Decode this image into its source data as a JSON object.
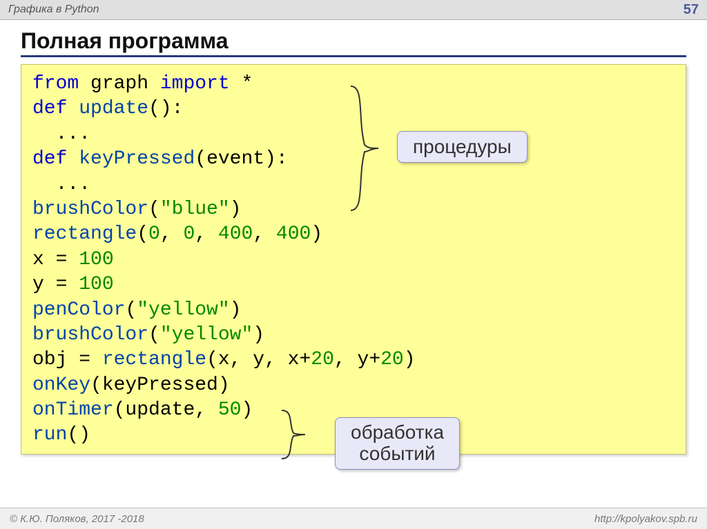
{
  "header": {
    "title": "Графика в Python",
    "page": "57"
  },
  "slide_title": "Полная программа",
  "callouts": {
    "procedures": "процедуры",
    "events_line1": "обработка",
    "events_line2": "событий"
  },
  "code": {
    "l1_from": "from",
    "l1_graph": " graph ",
    "l1_import": "import",
    "l1_star": " *",
    "l2_def": "def",
    "l2_update": " update",
    "l2_par": "():",
    "l3": "  ...",
    "l4_def": "def",
    "l4_kp": " keyPressed",
    "l4_par": "(event):",
    "l5": "  ...",
    "l6_bc": "brushColor",
    "l6_par_open": "(",
    "l6_str": "\"blue\"",
    "l6_par_close": ")",
    "l7_rect": "rectangle",
    "l7_open": "(",
    "l7_n1": "0",
    "l7_c1": ", ",
    "l7_n2": "0",
    "l7_c2": ", ",
    "l7_n3": "400",
    "l7_c3": ", ",
    "l7_n4": "400",
    "l7_close": ")",
    "l8_x": "x = ",
    "l8_n": "100",
    "l9_y": "y = ",
    "l9_n": "100",
    "l10_pc": "penColor",
    "l10_open": "(",
    "l10_str": "\"yellow\"",
    "l10_close": ")",
    "l11_bc": "brushColor",
    "l11_open": "(",
    "l11_str": "\"yellow\"",
    "l11_close": ")",
    "l12_obj": "obj = ",
    "l12_rect": "rectangle",
    "l12_open": "(x, y, x+",
    "l12_n1": "20",
    "l12_mid": ", y+",
    "l12_n2": "20",
    "l12_close": ")",
    "l13_ok": "onKey",
    "l13_par": "(keyPressed)",
    "l14_ot": "onTimer",
    "l14_open": "(update, ",
    "l14_n": "50",
    "l14_close": ")",
    "l15_run": "run",
    "l15_par": "()"
  },
  "footer": {
    "left": "© К.Ю. Поляков, 2017 -2018",
    "right": "http://kpolyakov.spb.ru"
  }
}
